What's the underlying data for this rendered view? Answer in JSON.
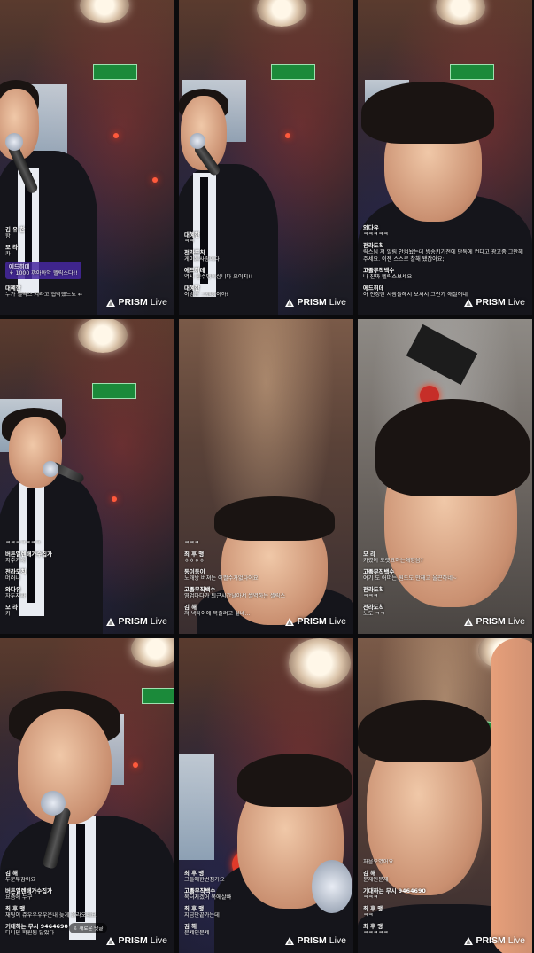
{
  "brand": {
    "name": "PRISM",
    "suffix": "Live"
  },
  "panels": [
    {
      "chat": [
        {
          "name": "김 유 한",
          "msg": "함"
        },
        {
          "name": "모 라",
          "msg": "카"
        },
        {
          "name": "에드히데",
          "msg": "⚘ 1000 꺄아아악 헬릭스다!!",
          "donation": true
        },
        {
          "name": "대혜한",
          "msg": "누가 셀릭스 켜라고 협박했느뇨 ←"
        }
      ]
    },
    {
      "chat": [
        {
          "name": "대혜한",
          "msg": "ㅋㅋ"
        },
        {
          "name": "전라도칙",
          "msg": "게이된사랑이다"
        },
        {
          "name": "에드히데",
          "msg": "역시 원수맹이십니다 오이지!!"
        },
        {
          "name": "대혜한",
          "msg": "이방은 그랜방이야!"
        }
      ]
    },
    {
      "chat": [
        {
          "name": "와다유",
          "msg": "ㅋㅋㅋㅋㅋ"
        },
        {
          "name": "전라도칙",
          "msg": "릭스님 저 알림 안켜놨는데 방송키기전에 단톡에 컨다고 광고좀 그만해주세요. 이젠 스스로 찰해 됐잖아요;;"
        },
        {
          "name": "고졸무직백수",
          "msg": "나 진짜 헬릭스보세요"
        },
        {
          "name": "에드히데",
          "msg": "아 진정한 사람들해서 보셔서 그런가 애절허네"
        }
      ]
    },
    {
      "chat": [
        {
          "name": "",
          "msg": "ㅋㅋㅋㅋㅋㅋㅋ"
        },
        {
          "name": "버튼얼렌배가수집가",
          "msg": "치주거해"
        },
        {
          "name": "전라도칙",
          "msg": "머러나"
        },
        {
          "name": "와다유",
          "msg": "자두지자"
        },
        {
          "name": "모 라",
          "msg": "카"
        }
      ]
    },
    {
      "chat": [
        {
          "name": "",
          "msg": "ㅋㅋㅋ"
        },
        {
          "name": "최 후 맹",
          "msg": "ㅎㅎㅎㅎ"
        },
        {
          "name": "동이동이",
          "msg": "노래방 버쳐는 어쩔수가없다어요"
        },
        {
          "name": "고졸무직백수",
          "msg": "영업마다가 퇴근시간날아서 썰역하는 셀릭스"
        },
        {
          "name": "김 해",
          "msg": "저 넥타이에 목졸려고 싶네..."
        }
      ]
    },
    {
      "chat": [
        {
          "name": "모 라",
          "msg": "카렸이 오랫요하는애멍음?"
        },
        {
          "name": "고졸무직백수",
          "msg": "여기 도 어떠는 원도도 만해고 울끈하네~"
        },
        {
          "name": "전라도칙",
          "msg": "ㅋㅋㅋ"
        },
        {
          "name": "전라도칙",
          "msg": "노도 ㄱㄱ"
        }
      ]
    },
    {
      "chat": [
        {
          "name": "김 해",
          "msg": "두문무감이요"
        },
        {
          "name": "버튼얼렌배가수집가",
          "msg": "요즘에 누구"
        },
        {
          "name": "최 후 맹",
          "msg": "채팅이 쥬우우우우운내 늦게 올라오네요"
        },
        {
          "name": "기대하는 무시 9464690",
          "msg": "디니던 학원됨 닮았다"
        }
      ],
      "pill": "⇩ 새로운 댓글"
    },
    {
      "chat": [
        {
          "name": "최 후 맹",
          "msg": "그들에한번짐거요"
        },
        {
          "name": "고졸무직백수",
          "msg": "목터지겠어 목에살빠"
        },
        {
          "name": "최 후 맹",
          "msg": "지금만끝가는데"
        },
        {
          "name": "김 해",
          "msg": "문제인문제"
        }
      ]
    },
    {
      "chat": [
        {
          "name": "",
          "msg": "처음오였어요"
        },
        {
          "name": "김 해",
          "msg": "문재인문재"
        },
        {
          "name": "기대하는 무시 9464690",
          "msg": "ㅋㅋㅋ"
        },
        {
          "name": "최 후 맹",
          "msg": "ㅋㅋ"
        },
        {
          "name": "최 후 맹",
          "msg": "ㅋㅋㅋㅋㅋ"
        }
      ]
    }
  ]
}
